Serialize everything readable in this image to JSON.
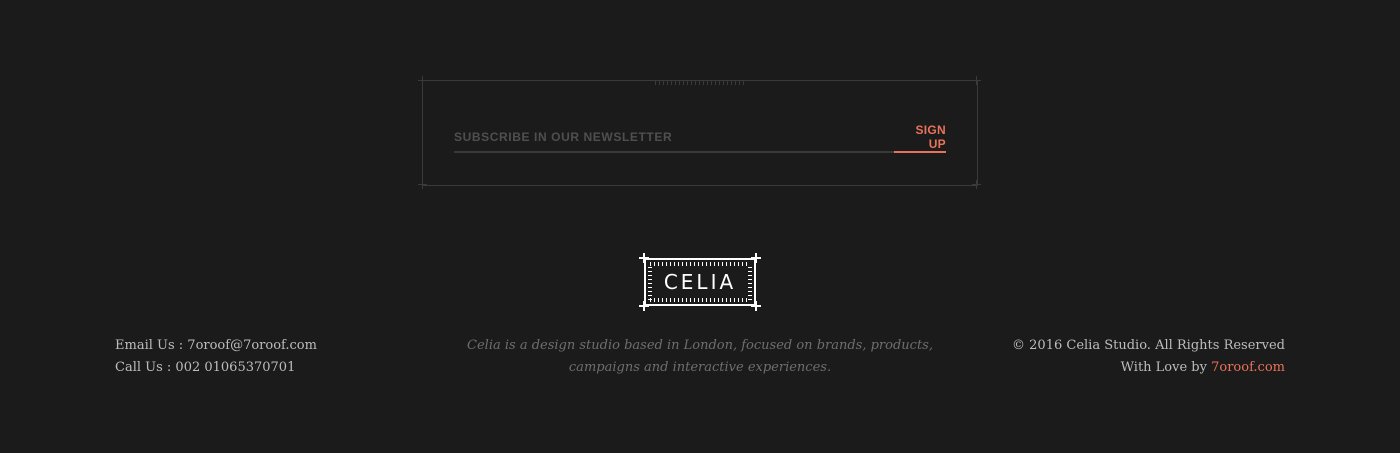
{
  "newsletter": {
    "placeholder": "SUBSCRIBE IN OUR NEWSLETTER",
    "value": "",
    "button_label": "SIGN UP"
  },
  "logo": {
    "text": "CELIA"
  },
  "contact": {
    "email_label": "Email Us : ",
    "email": "7oroof@7oroof.com",
    "phone_label": "Call Us : ",
    "phone": "002 01065370701"
  },
  "description": {
    "text": "Celia is a design studio based in London, focused on brands, products, campaigns and interactive experiences."
  },
  "copyright": {
    "text": "© 2016 Celia Studio. All Rights Reserved",
    "love_prefix": "With Love by ",
    "love_link": "7oroof.com"
  },
  "colors": {
    "background": "#1b1b1b",
    "accent": "#e9725a",
    "border": "#3a3a3a",
    "text": "#bdbdbd",
    "muted": "#6e6e6e"
  }
}
